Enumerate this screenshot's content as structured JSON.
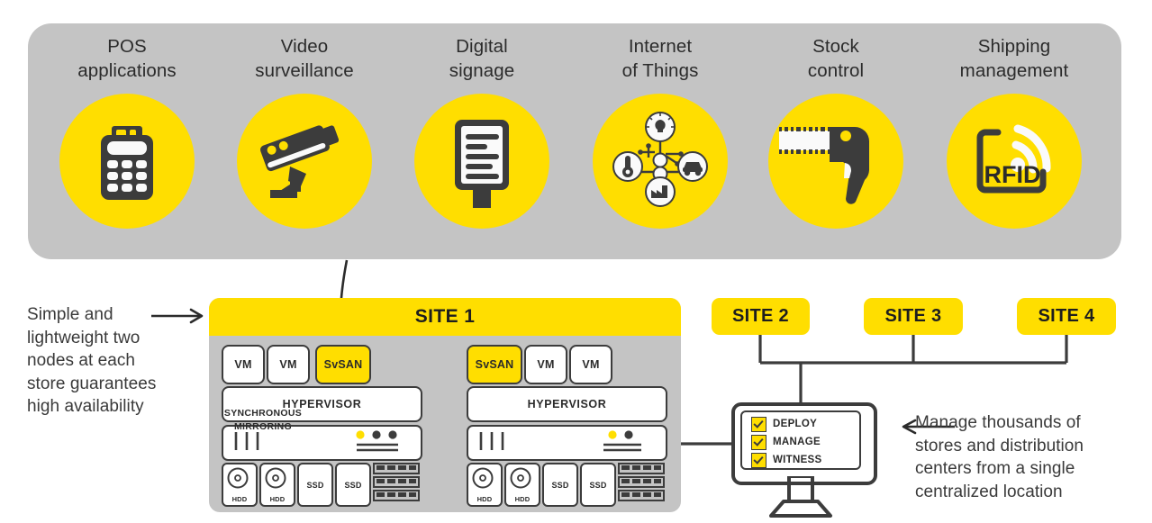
{
  "colors": {
    "yellow": "#ffde00",
    "grey_panel": "#c4c4c4",
    "dark": "#3c3c3c",
    "text": "#2b2b2b",
    "white": "#ffffff"
  },
  "applications": [
    {
      "label": "POS\napplications",
      "icon": "pos-terminal-icon"
    },
    {
      "label": "Video\nsurveillance",
      "icon": "security-camera-icon"
    },
    {
      "label": "Digital\nsignage",
      "icon": "digital-signage-icon"
    },
    {
      "label": "Internet\nof Things",
      "icon": "iot-network-icon"
    },
    {
      "label": "Stock\ncontrol",
      "icon": "barcode-scanner-icon"
    },
    {
      "label": "Shipping\nmanagement",
      "icon": "rfid-tag-icon"
    }
  ],
  "site1": {
    "title": "SITE 1",
    "sync_label": "SYNCHRONOUS\nMIRRORING",
    "left_node": {
      "chips": [
        "VM",
        "VM",
        "SvSAN"
      ],
      "hypervisor": "HYPERVISOR",
      "drives": [
        "HDD",
        "HDD",
        "SSD",
        "SSD"
      ],
      "server_leds": 3
    },
    "right_node": {
      "chips": [
        "SvSAN",
        "VM",
        "VM"
      ],
      "hypervisor": "HYPERVISOR",
      "drives": [
        "HDD",
        "HDD",
        "SSD",
        "SSD"
      ],
      "server_leds": 2
    }
  },
  "other_sites": [
    {
      "title": "SITE 2"
    },
    {
      "title": "SITE 3"
    },
    {
      "title": "SITE 4"
    }
  ],
  "monitor": {
    "checklist": [
      {
        "label": "DEPLOY",
        "checked": true
      },
      {
        "label": "MANAGE",
        "checked": true
      },
      {
        "label": "WITNESS",
        "checked": true
      }
    ]
  },
  "annotations": {
    "left": "Simple and\nlightweight two\nnodes at each\nstore guarantees\nhigh availability",
    "right": "Manage thousands of\nstores and distribution\ncenters from a single\ncentralized location"
  }
}
